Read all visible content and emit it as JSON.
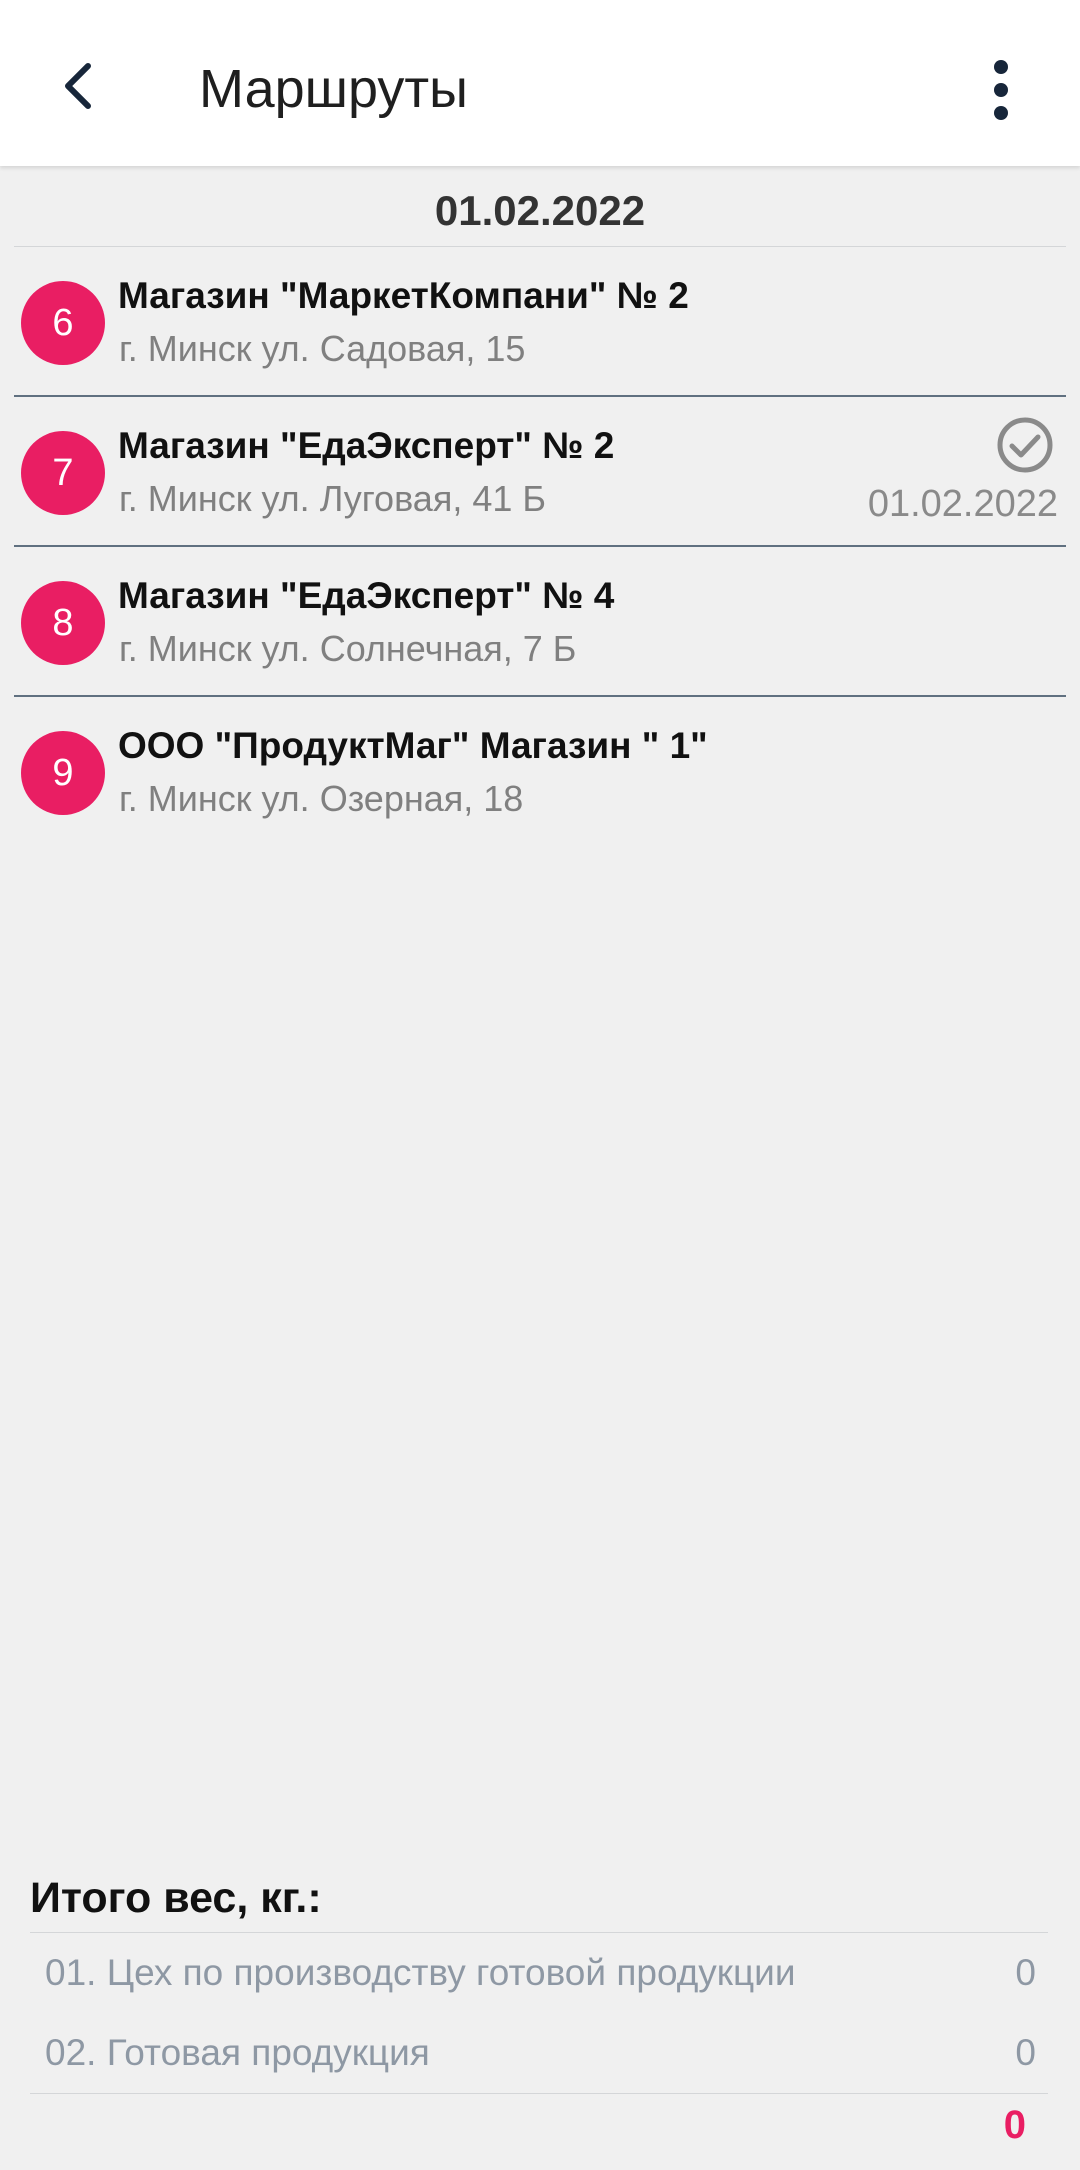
{
  "appbar": {
    "title": "Маршруты",
    "back_icon": "chevron-left-icon",
    "menu_icon": "more-vert-icon"
  },
  "date_header": "01.02.2022",
  "routes": [
    {
      "number": "6",
      "name": "Магазин \"МаркетКомпани\" № 2",
      "address": "г. Минск ул. Садовая, 15",
      "visited": false,
      "visit_date": ""
    },
    {
      "number": "7",
      "name": "Магазин \"ЕдаЭксперт\" № 2",
      "address": "г. Минск ул. Луговая, 41 Б",
      "visited": true,
      "visit_date": "01.02.2022"
    },
    {
      "number": "8",
      "name": "Магазин \"ЕдаЭксперт\" № 4",
      "address": "г. Минск ул. Солнечная, 7 Б",
      "visited": false,
      "visit_date": ""
    },
    {
      "number": "9",
      "name": "ООО \"ПродуктМаг\" Магазин \" 1\"",
      "address": "г. Минск ул. Озерная, 18",
      "visited": false,
      "visit_date": ""
    }
  ],
  "totals": {
    "title": "Итого вес, кг.:",
    "rows": [
      {
        "label": "01. Цех по производству готовой продукции",
        "value": "0"
      },
      {
        "label": "02. Готовая продукция",
        "value": "0"
      }
    ],
    "grand_total": "0"
  },
  "colors": {
    "accent": "#e91e63",
    "divider": "#607080",
    "background": "#f0f0f0"
  }
}
